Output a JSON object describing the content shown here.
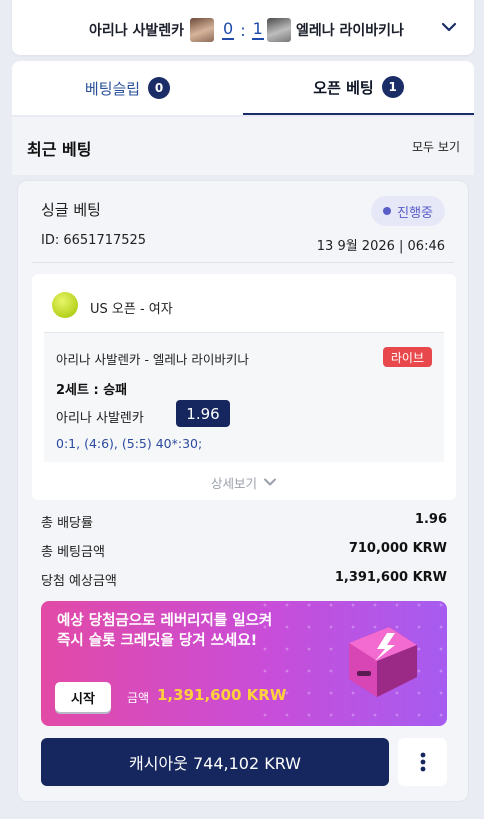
{
  "scoreboard": {
    "player1": "아리나 사발렌카",
    "score1": "0",
    "score_sep": ":",
    "score2": "1",
    "player2": "엘레나 라이바키나"
  },
  "tabs": [
    {
      "label": "베팅슬립",
      "count": "0"
    },
    {
      "label": "오픈 베팅",
      "count": "1"
    }
  ],
  "recent": {
    "title": "최근 베팅",
    "view_all": "모두 보기"
  },
  "bet": {
    "type": "싱글 베팅",
    "status": "진행중",
    "id": "ID: 6651717525",
    "date": "13 9월 2026 | 06:46",
    "selection": {
      "league": "US 오픈 - 여자",
      "match": "아리나 사발렌카 - 엘레나 라이바키나",
      "live_label": "라이브",
      "market": "2세트 : 승패",
      "pick": "아리나 사발렌카",
      "odds": "1.96",
      "score": "0:1, (4:6), (5:5) 40*:30;"
    },
    "details_label": "상세보기",
    "summary": [
      {
        "label": "총 배당률",
        "value": "1.96"
      },
      {
        "label": "총 베팅금액",
        "value": "710,000 KRW"
      },
      {
        "label": "당첨 예상금액",
        "value": "1,391,600 KRW"
      }
    ],
    "promo": {
      "text": "예상 당첨금으로 레버리지를 일으켜 즉시 슬롯 크레딧을 당겨 쓰세요!",
      "button": "시작",
      "amount_label": "금액",
      "amount": "1,391,600 KRW"
    },
    "cashout": "캐시아웃 744,102 KRW"
  },
  "colors": {
    "navy": "#16275f",
    "live_red": "#e8484b",
    "status_purple": "#5a5ec9",
    "promo_gold": "#ffd23c"
  },
  "icons": [
    "chevron-down-icon",
    "tennis-ball-icon",
    "lightning-chip-icon",
    "more-vertical-icon"
  ]
}
